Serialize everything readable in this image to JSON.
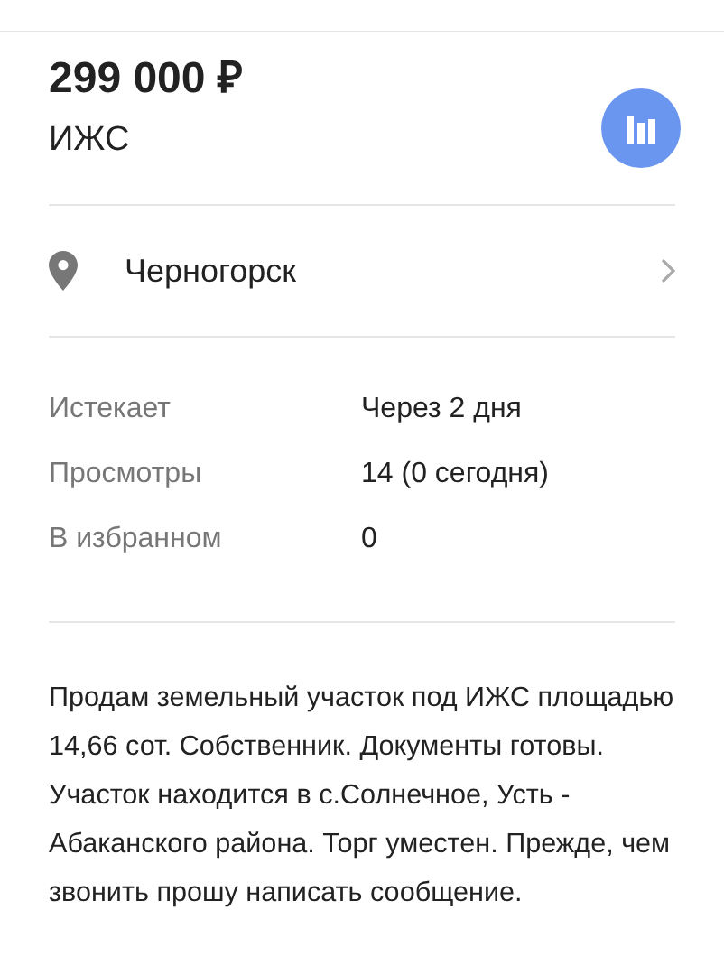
{
  "price": "299 000 ₽",
  "category": "ИЖС",
  "location": {
    "city": "Черногорск"
  },
  "stats": [
    {
      "label": "Истекает",
      "value": "Через 2 дня"
    },
    {
      "label": "Просмотры",
      "value": "14 (0 сегодня)"
    },
    {
      "label": "В избранном",
      "value": "0"
    }
  ],
  "description": "Продам земельный участок под ИЖС площадью 14,66 сот. Собственник. Документы готовы. Участок находится в с.Солнечное, Усть - Абаканского района. Торг уместен. Прежде, чем звонить прошу написать сообщение."
}
